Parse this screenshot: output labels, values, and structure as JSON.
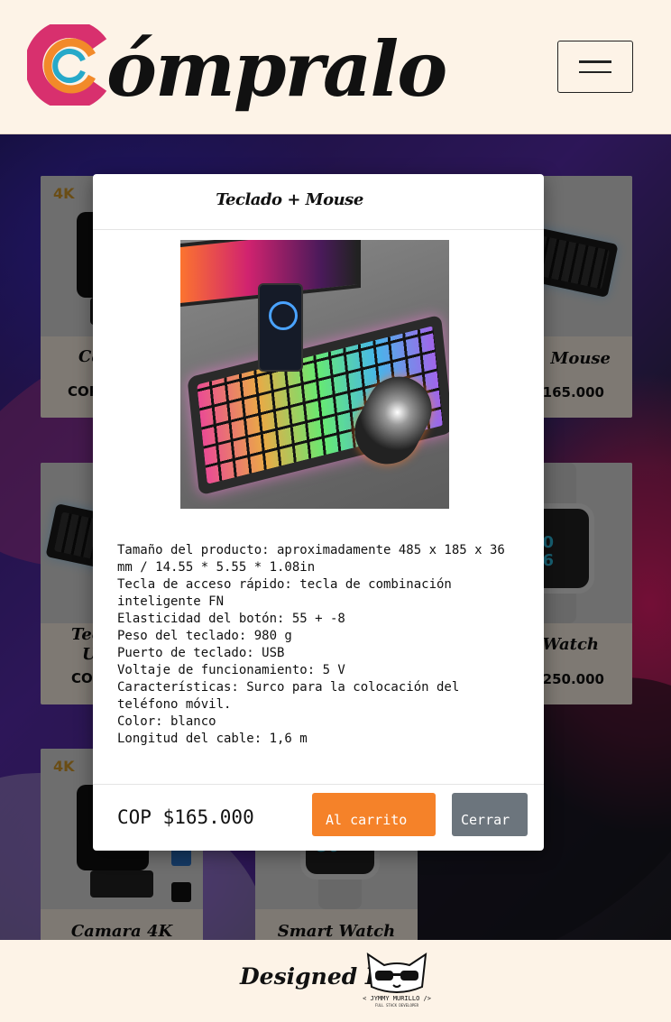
{
  "header": {
    "brand": "ómpralo",
    "menu_button": "menu"
  },
  "colors": {
    "background": "#fdf3e7",
    "logo_pink": "#d8306e",
    "logo_orange": "#f28a2a",
    "logo_blue": "#27a9c9",
    "cart_button": "#f58229",
    "close_button": "#6c757d"
  },
  "products": [
    {
      "title": "Camara 4K",
      "price": "COP $165.000",
      "visible_title": "Ca",
      "visible_price": "COP"
    },
    {
      "title": "Teclado + Mouse",
      "price": "COP $165.000",
      "visible_title": "+ Mouse",
      "visible_price": "$165.000"
    },
    {
      "title": "Teclado + Mouse",
      "price": "COP $165.000",
      "visible_title": "Tec",
      "visible_sub": "U",
      "visible_price": "CO"
    },
    {
      "title": "Smart Watch",
      "price": "COP $250.000",
      "visible_title": "t Watch",
      "visible_price": "$250.000"
    },
    {
      "title": "Camara 4K",
      "price": "",
      "visible_title": "Camara 4K"
    },
    {
      "title": "Smart Watch",
      "price": "",
      "visible_title": "Smart Watch"
    }
  ],
  "camera_image": {
    "tag": "4K"
  },
  "modal": {
    "title": "Teclado + Mouse",
    "description": [
      "Tamaño del producto: aproximadamente 485 x 185 x 36 mm / 14.55 * 5.55 * 1.08in",
      "Tecla de acceso rápido: tecla de combinación inteligente FN",
      "Elasticidad del botón: 55 + -8",
      "Peso del teclado: 980 g",
      "Puerto de teclado: USB",
      "Voltaje de funcionamiento: 5 V",
      "Características: Surco para la colocación del teléfono móvil.",
      "Color: blanco",
      "Longitud del cable: 1,6 m"
    ],
    "price": "COP $165.000",
    "cart_button": "Al carrito",
    "close_button": "Cerrar"
  },
  "footer": {
    "designed_by": "Designed By",
    "author": "< JYMMY MURILLO />",
    "author_sub": "FULL STACK DEVELOPER"
  }
}
